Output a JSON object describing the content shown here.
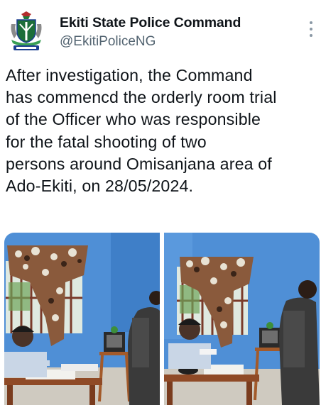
{
  "author": {
    "display_name": "Ekiti State Police Command",
    "handle": "@EkitiPoliceNG",
    "avatar_icon": "nigeria-police-crest-icon"
  },
  "tweet": {
    "text": "After investigation, the Command\nhas commencd the orderly room trial\nof the Officer who was responsible\nfor the fatal shooting of two\npersons around Omisanjana area of\nAdo-Ekiti, on 28/05/2024."
  },
  "menu": {
    "icon": "more-vertical-icon"
  },
  "media": {
    "count": 2,
    "items": [
      {
        "icon": "photo-icon",
        "description_icon": "orderly-room-trial-photo-1"
      },
      {
        "icon": "photo-icon",
        "description_icon": "orderly-room-trial-photo-2"
      }
    ]
  },
  "colors": {
    "text": "#0f1419",
    "secondary": "#536471",
    "wall": "#4f8fd6"
  }
}
